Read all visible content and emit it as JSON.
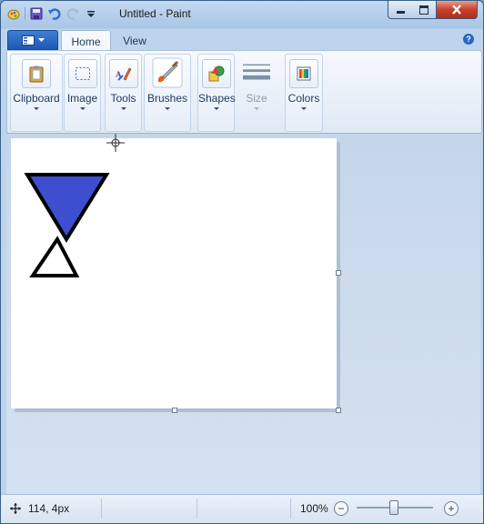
{
  "window": {
    "title": "Untitled - Paint"
  },
  "quick_access": {
    "icons": [
      "paint-app-icon",
      "save-icon",
      "undo-icon",
      "redo-icon",
      "customize-dropdown-icon"
    ]
  },
  "ribbon": {
    "tabs": [
      {
        "label": "Home",
        "selected": true
      },
      {
        "label": "View",
        "selected": false
      }
    ],
    "groups": {
      "clipboard": {
        "label": "Clipboard",
        "icon": "clipboard-icon"
      },
      "image": {
        "label": "Image",
        "icon": "select-icon"
      },
      "tools": {
        "label": "Tools",
        "icon": "tools-icon"
      },
      "brushes": {
        "label": "Brushes",
        "icon": "brush-icon"
      },
      "shapes": {
        "label": "Shapes",
        "icon": "shapes-icon"
      },
      "size": {
        "label": "Size",
        "icon": "size-lines-icon",
        "enabled": false
      },
      "colors": {
        "label": "Colors",
        "icon": "color-palette-icon"
      }
    }
  },
  "canvas": {
    "shapes": [
      {
        "type": "triangle",
        "fill": "#3d4fcf",
        "stroke": "#000000"
      },
      {
        "type": "triangle",
        "fill": "#ffffff",
        "stroke": "#000000"
      }
    ]
  },
  "status": {
    "cursor_position": "114, 4px",
    "zoom": "100%"
  },
  "colors": {
    "shape_fill": "#3d4fcf",
    "close_button": "#c7402a",
    "ribbon_accent": "#1d58b5"
  }
}
